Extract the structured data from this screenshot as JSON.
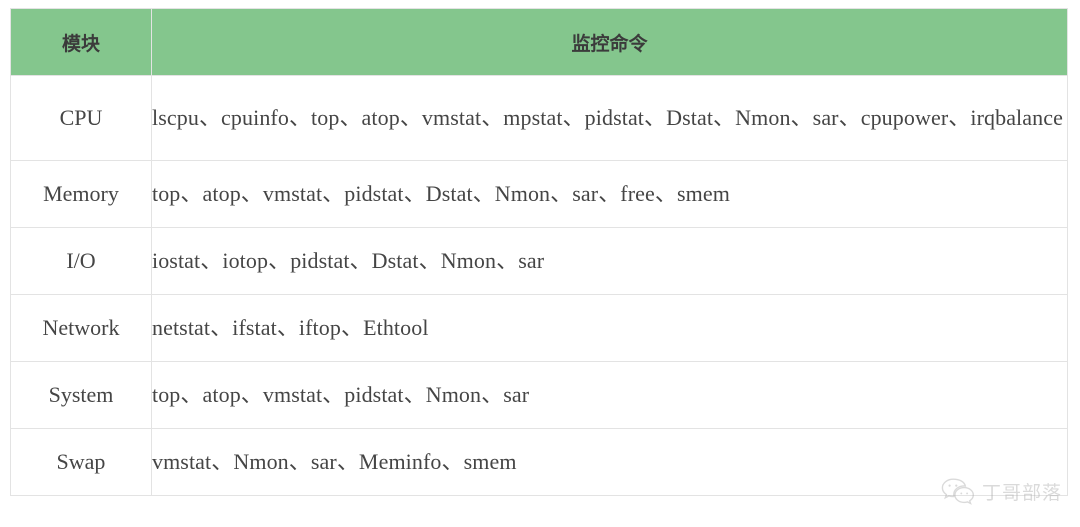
{
  "table": {
    "headers": {
      "module": "模块",
      "command": "监控命令"
    },
    "rows": [
      {
        "module": "CPU",
        "commands": "lscpu、cpuinfo、top、atop、vmstat、mpstat、pidstat、Dstat、Nmon、sar、cpupower、irqbalance"
      },
      {
        "module": "Memory",
        "commands": "top、atop、vmstat、pidstat、Dstat、Nmon、sar、free、smem"
      },
      {
        "module": "I/O",
        "commands": "iostat、iotop、pidstat、Dstat、Nmon、sar"
      },
      {
        "module": "Network",
        "commands": "netstat、ifstat、iftop、Ethtool"
      },
      {
        "module": "System",
        "commands": "top、atop、vmstat、pidstat、Nmon、sar"
      },
      {
        "module": "Swap",
        "commands": "vmstat、Nmon、sar、Meminfo、smem"
      }
    ]
  },
  "watermark": {
    "icon": "wechat-icon",
    "text": "丁哥部落"
  },
  "colors": {
    "header_background": "#84c68d",
    "header_text": "#3b3b3b",
    "body_text": "#454545",
    "border": "#e3e3e3",
    "watermark_text": "#a8a8a8"
  }
}
